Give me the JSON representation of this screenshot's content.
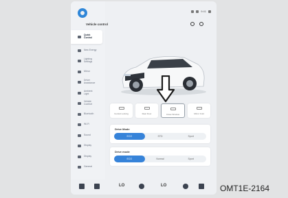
{
  "screen": {
    "title": "Vehicle control",
    "status_text": "9:41",
    "sidebar": {
      "items": [
        {
          "label": "Quick\nControl",
          "icon": "car-icon",
          "active": true
        },
        {
          "label": "New Energy",
          "icon": "bolt-icon"
        },
        {
          "label": "Lighting\nSettings",
          "icon": "light-icon"
        },
        {
          "label": "Mirror",
          "icon": "mirror-icon"
        },
        {
          "label": "Driver\nAssistance",
          "icon": "steering-icon"
        },
        {
          "label": "Ambient\nLight",
          "icon": "ambient-icon"
        },
        {
          "label": "Vehicle\nComfort",
          "icon": "seat-icon"
        },
        {
          "label": "Bluetooth",
          "icon": "bluetooth-icon"
        },
        {
          "label": "Wi-Fi",
          "icon": "wifi-icon"
        },
        {
          "label": "Sound",
          "icon": "sound-icon"
        },
        {
          "label": "Display",
          "icon": "display-icon"
        },
        {
          "label": "Display",
          "icon": "brightness-icon"
        },
        {
          "label": "General",
          "icon": "general-icon"
        }
      ]
    },
    "tiles": [
      {
        "label": "Central Locking",
        "icon": "lock-icon"
      },
      {
        "label": "Rear Door",
        "icon": "door-icon"
      },
      {
        "label": "Close Window",
        "icon": "window-icon",
        "selected": true
      },
      {
        "label": "Mirror Fold",
        "icon": "mirror-fold-icon"
      }
    ],
    "cards": [
      {
        "title": "Drive Mode",
        "options": [
          "ECO",
          "STD",
          "Sport"
        ],
        "selected": 0
      },
      {
        "title": "Drive mode",
        "options": [
          "ECO",
          "Normal",
          "Sport"
        ],
        "selected": 0
      }
    ],
    "bottom_bar": {
      "temp_left": "LO",
      "temp_right": "LO"
    }
  },
  "figure_code": "OMT1E-2164",
  "colors": {
    "accent": "#3683d9",
    "arrow": "#1a1a1a"
  }
}
